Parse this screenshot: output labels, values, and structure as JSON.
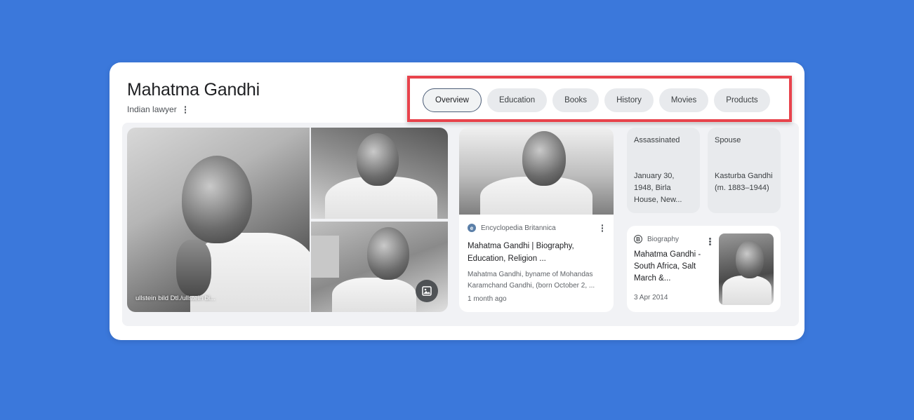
{
  "header": {
    "title": "Mahatma Gandhi",
    "subtitle": "Indian lawyer"
  },
  "tabs": [
    {
      "label": "Overview",
      "active": true
    },
    {
      "label": "Education",
      "active": false
    },
    {
      "label": "Books",
      "active": false
    },
    {
      "label": "History",
      "active": false
    },
    {
      "label": "Movies",
      "active": false
    },
    {
      "label": "Products",
      "active": false
    }
  ],
  "images": {
    "credit": "ullstein bild Dtl./ullstein bi..."
  },
  "britannica_result": {
    "source": "Encyclopedia Britannica",
    "title": "Mahatma Gandhi | Biography, Education, Religion ...",
    "snippet": "Mahatma Gandhi, byname of Mohandas Karamchand Gandhi, (born October 2, ...",
    "date": "1 month ago"
  },
  "facts": [
    {
      "label": "Assassinated",
      "value": "January 30, 1948, Birla House, New..."
    },
    {
      "label": "Spouse",
      "value": "Kasturba Gandhi (m. 1883–1944)"
    }
  ],
  "biography_result": {
    "source": "Biography",
    "title": "Mahatma Gandhi - South Africa, Salt March &...",
    "date": "3 Apr 2014"
  },
  "colors": {
    "background": "#3b78db",
    "highlight_border": "#e8434c",
    "chip_bg": "#e8eaed",
    "active_chip_border": "#4d5e78"
  },
  "icons": [
    "more-vert-icon",
    "image-gallery-icon",
    "britannica-icon",
    "biography-icon"
  ]
}
